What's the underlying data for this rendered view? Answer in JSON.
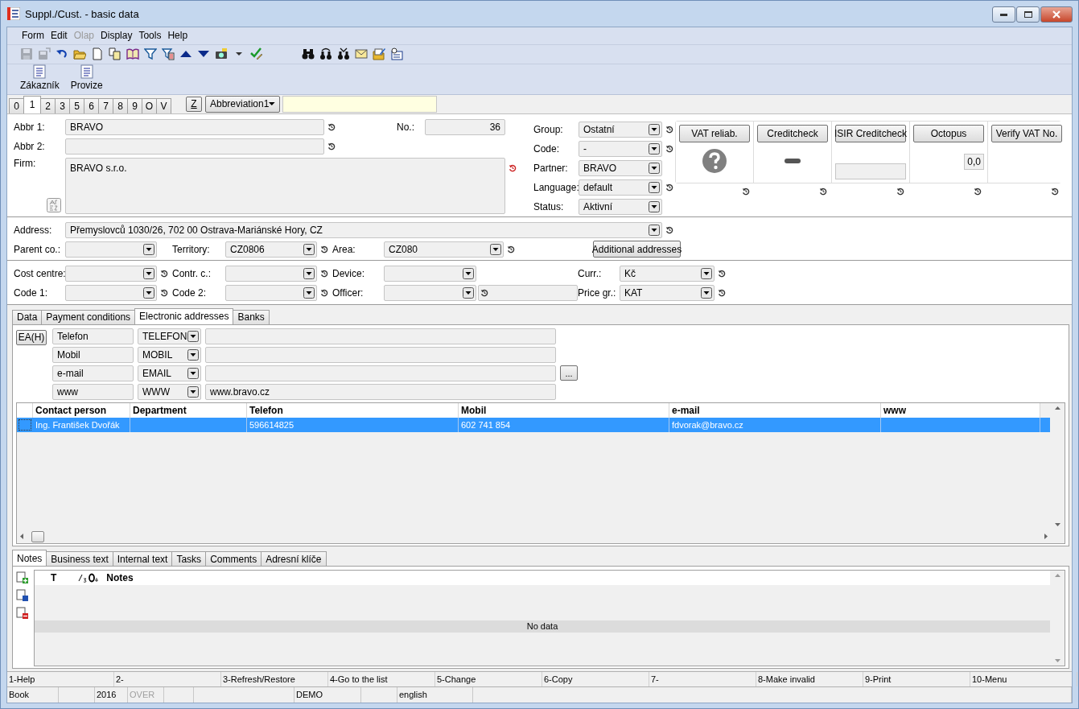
{
  "window": {
    "title": "Suppl./Cust. - basic data"
  },
  "menu": [
    {
      "label": "Form",
      "disabled": false
    },
    {
      "label": "Edit",
      "disabled": false
    },
    {
      "label": "Olap",
      "disabled": true
    },
    {
      "label": "Display",
      "disabled": false
    },
    {
      "label": "Tools",
      "disabled": false
    },
    {
      "label": "Help",
      "disabled": false
    }
  ],
  "toolbar": {
    "left": [
      {
        "kind": "save",
        "disabled": true
      },
      {
        "kind": "save-as",
        "disabled": true
      },
      {
        "kind": "undo",
        "disabled": false
      },
      {
        "kind": "open",
        "disabled": false
      },
      {
        "kind": "new",
        "disabled": false
      },
      {
        "kind": "copy",
        "disabled": false
      },
      {
        "kind": "book",
        "disabled": false
      },
      {
        "kind": "filter",
        "disabled": false
      },
      {
        "kind": "filter-list",
        "disabled": false
      },
      {
        "kind": "up",
        "disabled": false
      },
      {
        "kind": "down",
        "disabled": false
      },
      {
        "kind": "camera",
        "disabled": false
      },
      {
        "kind": "caret",
        "disabled": false
      },
      {
        "kind": "check-edit",
        "disabled": false
      }
    ],
    "right": [
      {
        "kind": "binoculars",
        "disabled": false
      },
      {
        "kind": "binoculars-up",
        "disabled": false
      },
      {
        "kind": "binoculars-down",
        "disabled": false
      },
      {
        "kind": "mail",
        "disabled": false
      },
      {
        "kind": "folder-edit",
        "disabled": false
      },
      {
        "kind": "card",
        "disabled": false
      }
    ]
  },
  "big_toolbar": [
    {
      "label": "Zákazník"
    },
    {
      "label": "Provize"
    }
  ],
  "page_tabs": [
    {
      "label": "0",
      "selected": false
    },
    {
      "label": "1",
      "selected": true
    },
    {
      "label": "2",
      "selected": false
    },
    {
      "label": "3",
      "selected": false
    },
    {
      "label": "5",
      "selected": false
    },
    {
      "label": "6",
      "selected": false
    },
    {
      "label": "7",
      "selected": false
    },
    {
      "label": "8",
      "selected": false
    },
    {
      "label": "9",
      "selected": false
    },
    {
      "label": "O",
      "selected": false
    },
    {
      "label": "V",
      "selected": false
    }
  ],
  "filter_bar": {
    "z_button": "Z",
    "sort": "Abbreviation1"
  },
  "header": {
    "abbr1": {
      "label": "Abbr 1:",
      "value": "BRAVO",
      "history": true
    },
    "abbr2": {
      "label": "Abbr 2:",
      "history": true
    },
    "firm": {
      "label": "Firm:",
      "value": "BRAVO s.r.o.",
      "history": true,
      "history_alert": true
    },
    "number": {
      "label": "No.:",
      "value": "36"
    }
  },
  "classification": [
    {
      "label": "Group:",
      "value": "Ostatní",
      "history": true
    },
    {
      "label": "Code:",
      "value": "-",
      "history": true
    },
    {
      "label": "Partner:",
      "value": "BRAVO"
    },
    {
      "label": "Language:",
      "value": "default",
      "history": true
    },
    {
      "label": "Status:",
      "value": "Aktivní"
    }
  ],
  "checks": [
    {
      "button": "VAT reliab.",
      "kind": "unknown",
      "history": true
    },
    {
      "button": "Creditcheck",
      "kind": "dash",
      "history": true
    },
    {
      "button": "ISIR Creditcheck",
      "kind": "field",
      "history": true
    },
    {
      "button": "Octopus",
      "kind": "value",
      "value": "0,0",
      "history": true
    },
    {
      "button": "Verify VAT No.",
      "kind": "empty",
      "history": true
    }
  ],
  "address": {
    "label": "Address:",
    "value": "Přemyslovců 1030/26, 702 00  Ostrava-Mariánské Hory, CZ",
    "history": true
  },
  "location_row": [
    {
      "kind": "select",
      "label": "Parent co.:"
    },
    {
      "kind": "select",
      "label": "Territory:",
      "value": "CZ0806",
      "history": true
    },
    {
      "kind": "select",
      "label": "Area:",
      "value": "CZ080",
      "history": true
    },
    {
      "kind": "button",
      "label": "Additional addresses"
    }
  ],
  "cost_rows": [
    [
      {
        "label": "Cost centre:",
        "history": true
      },
      {
        "label": "Contr. c.:",
        "history": true
      },
      {
        "label": "Device:"
      },
      {
        "label": "Curr.:",
        "value": "Kč",
        "history": true
      }
    ],
    [
      {
        "label": "Code 1:",
        "history": true
      },
      {
        "label": "Code 2:",
        "history": true
      },
      {
        "label": "Officer:",
        "name_field": {
          "history": true
        }
      },
      {
        "label": "Price gr.:",
        "value": "KAT",
        "history": true
      }
    ]
  ],
  "detail_tabs": [
    {
      "label": "Data",
      "selected": false
    },
    {
      "label": "Payment conditions",
      "selected": false
    },
    {
      "label": "Electronic addresses",
      "selected": true
    },
    {
      "label": "Banks",
      "selected": false
    }
  ],
  "ea_button": "EA(H)",
  "electronic_addresses": [
    {
      "name": "Telefon",
      "type": "TELEFON"
    },
    {
      "name": "Mobil",
      "type": "MOBIL"
    },
    {
      "name": "e-mail",
      "type": "EMAIL",
      "more_button": "..."
    },
    {
      "name": "www",
      "type": "WWW",
      "value": "www.bravo.cz"
    }
  ],
  "contacts": {
    "columns": [
      "Contact person",
      "Department",
      "Telefon",
      "Mobil",
      "e-mail",
      "www"
    ],
    "rows": [
      {
        "selected": true,
        "contact_person": "Ing. František Dvořák",
        "telefon": "596614825",
        "mobil": "602 741 854",
        "e_mail": "fdvorak@bravo.cz"
      }
    ]
  },
  "notes_tabs": [
    {
      "label": "Notes",
      "selected": true
    },
    {
      "label": "Business text",
      "selected": false
    },
    {
      "label": "Internal text",
      "selected": false
    },
    {
      "label": "Tasks",
      "selected": false
    },
    {
      "label": "Comments",
      "selected": false
    },
    {
      "label": "Adresní klíče",
      "selected": false
    }
  ],
  "notes": {
    "columns": [
      "T",
      "Notes"
    ],
    "empty_text": "No data"
  },
  "function_keys": [
    "1-Help",
    "2-",
    "3-Refresh/Restore",
    "4-Go to the list",
    "5-Change",
    "6-Copy",
    "7-",
    "8-Make invalid",
    "9-Print",
    "10-Menu"
  ],
  "status_bar": [
    {
      "kind": "text",
      "text": "Book",
      "disabled": false
    },
    {
      "kind": "empty"
    },
    {
      "kind": "text",
      "text": "2016",
      "disabled": false
    },
    {
      "kind": "text",
      "text": "OVER",
      "disabled": true
    },
    {
      "kind": "empty"
    },
    {
      "kind": "empty"
    },
    {
      "kind": "text",
      "text": "DEMO",
      "disabled": false
    },
    {
      "kind": "empty"
    },
    {
      "kind": "text",
      "text": "english",
      "disabled": false
    },
    {
      "kind": "empty"
    }
  ]
}
